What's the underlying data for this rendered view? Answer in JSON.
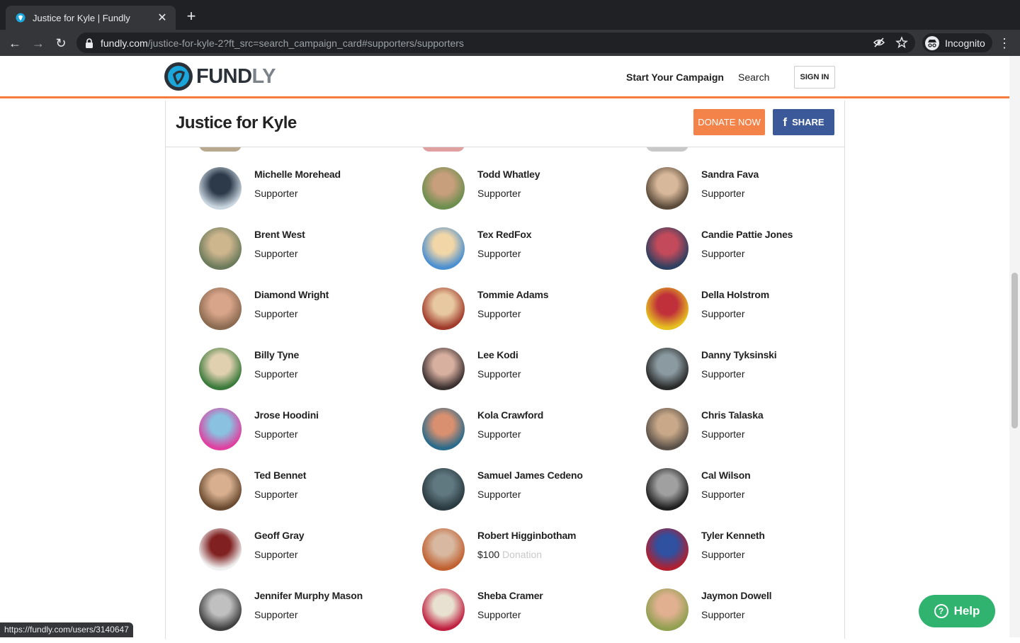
{
  "browser": {
    "tab_title": "Justice for Kyle | Fundly",
    "url_host": "fundly.com",
    "url_path": "/justice-for-kyle-2?ft_src=search_campaign_card#supporters/supporters",
    "incognito_label": "Incognito",
    "status_url": "https://fundly.com/users/3140647"
  },
  "site": {
    "logo_main": "FUND",
    "logo_accent": "LY",
    "nav_start": "Start Your Campaign",
    "nav_search": "Search",
    "signin": "SIGN IN",
    "brand_color": "#f47b3a"
  },
  "campaign": {
    "title": "Justice for Kyle",
    "donate_label": "DONATE NOW",
    "share_label": "SHARE"
  },
  "supporters": [
    {
      "name": "Michelle Morehead",
      "role": "Supporter"
    },
    {
      "name": "Todd Whatley",
      "role": "Supporter"
    },
    {
      "name": "Sandra Fava",
      "role": "Supporter"
    },
    {
      "name": "Brent West",
      "role": "Supporter"
    },
    {
      "name": "Tex RedFox",
      "role": "Supporter"
    },
    {
      "name": "Candie Pattie Jones",
      "role": "Supporter"
    },
    {
      "name": "Diamond Wright",
      "role": "Supporter"
    },
    {
      "name": "Tommie Adams",
      "role": "Supporter"
    },
    {
      "name": "Della Holstrom",
      "role": "Supporter"
    },
    {
      "name": "Billy Tyne",
      "role": "Supporter"
    },
    {
      "name": "Lee Kodi",
      "role": "Supporter"
    },
    {
      "name": "Danny Tyksinski",
      "role": "Supporter"
    },
    {
      "name": "Jrose Hoodini",
      "role": "Supporter"
    },
    {
      "name": "Kola Crawford",
      "role": "Supporter"
    },
    {
      "name": "Chris Talaska",
      "role": "Supporter"
    },
    {
      "name": "Ted Bennet",
      "role": "Supporter"
    },
    {
      "name": "Samuel James Cedeno",
      "role": "Supporter"
    },
    {
      "name": "Cal Wilson",
      "role": "Supporter"
    },
    {
      "name": "Geoff Gray",
      "role": "Supporter"
    },
    {
      "name": "Robert Higginbotham",
      "role": "$100",
      "role_suffix": "Donation"
    },
    {
      "name": "Tyler Kenneth",
      "role": "Supporter"
    },
    {
      "name": "Jennifer Murphy Mason",
      "role": "Supporter"
    },
    {
      "name": "Sheba Cramer",
      "role": "Supporter"
    },
    {
      "name": "Jaymon Dowell",
      "role": "Supporter"
    }
  ],
  "help_label": "Help"
}
